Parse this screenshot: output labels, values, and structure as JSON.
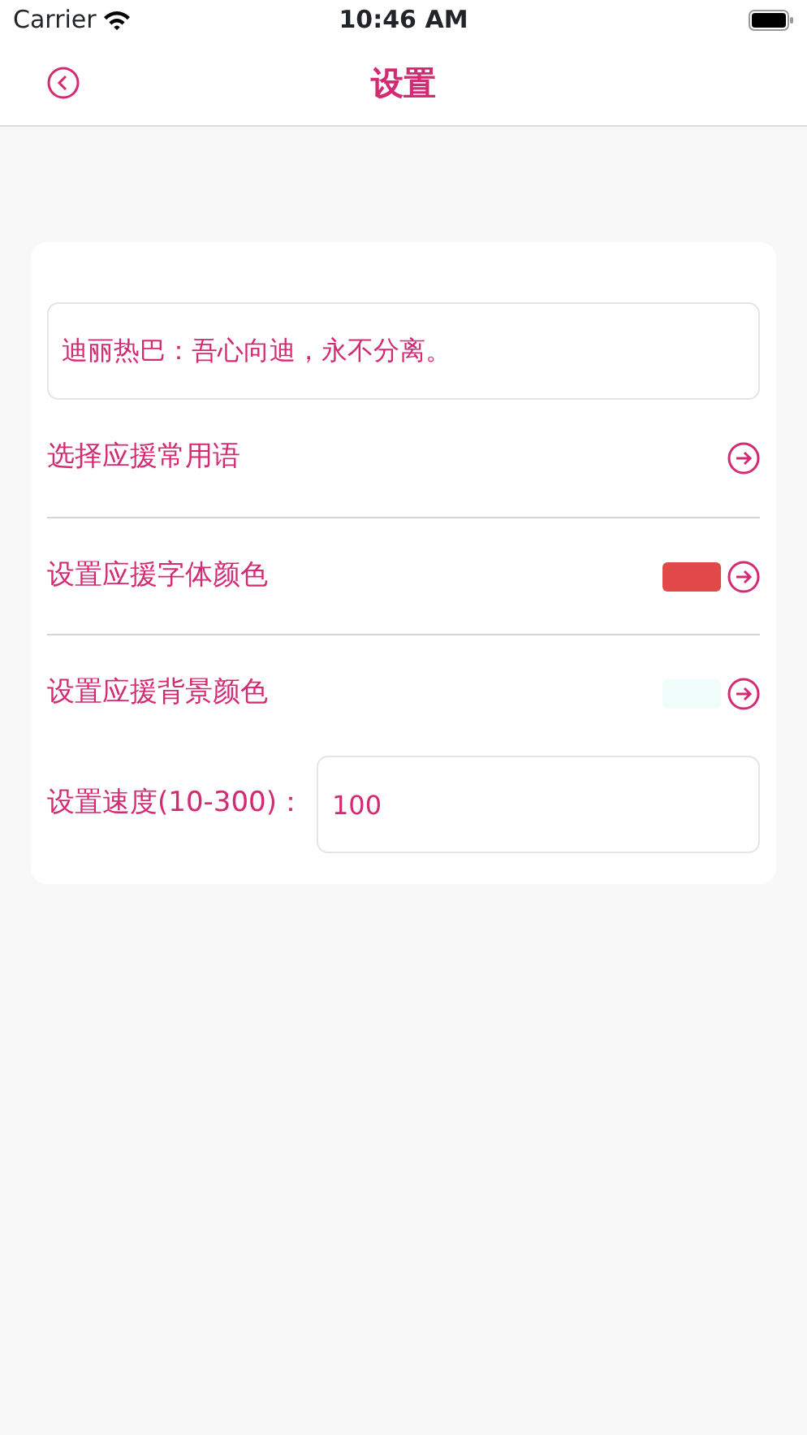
{
  "status_bar": {
    "carrier": "Carrier",
    "time": "10:46 AM"
  },
  "nav": {
    "title": "设置"
  },
  "message": {
    "value": "迪丽热巴：吾心向迪，永不分离。"
  },
  "rows": [
    {
      "kind": "link",
      "label": "选择应援常用语"
    },
    {
      "kind": "color",
      "label": "设置应援字体颜色",
      "color": "#e24a4a"
    },
    {
      "kind": "color",
      "label": "设置应援背景颜色",
      "color": "#f0fdfb"
    },
    {
      "kind": "input",
      "label": "设置速度(10-300)：",
      "value": "100"
    }
  ]
}
